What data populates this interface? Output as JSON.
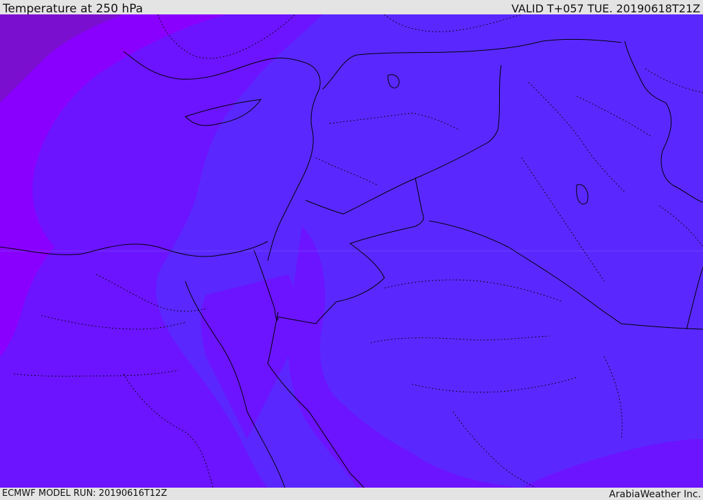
{
  "header": {
    "title": "Temperature at 250 hPa",
    "valid_time": "VALID T+057 TUE. 20190618T21Z"
  },
  "footer": {
    "model_run": "ECMWF MODEL RUN: 20190616T12Z",
    "credit": "ArabiaWeather Inc."
  },
  "map": {
    "colors": {
      "warmest_band": "#5a28ff",
      "mid_band": "#6c14ff",
      "cool_band": "#8a00ff",
      "coldest_band": "#7a0fd0",
      "border_line": "#000000",
      "grid_line": "#7a5cff"
    }
  }
}
